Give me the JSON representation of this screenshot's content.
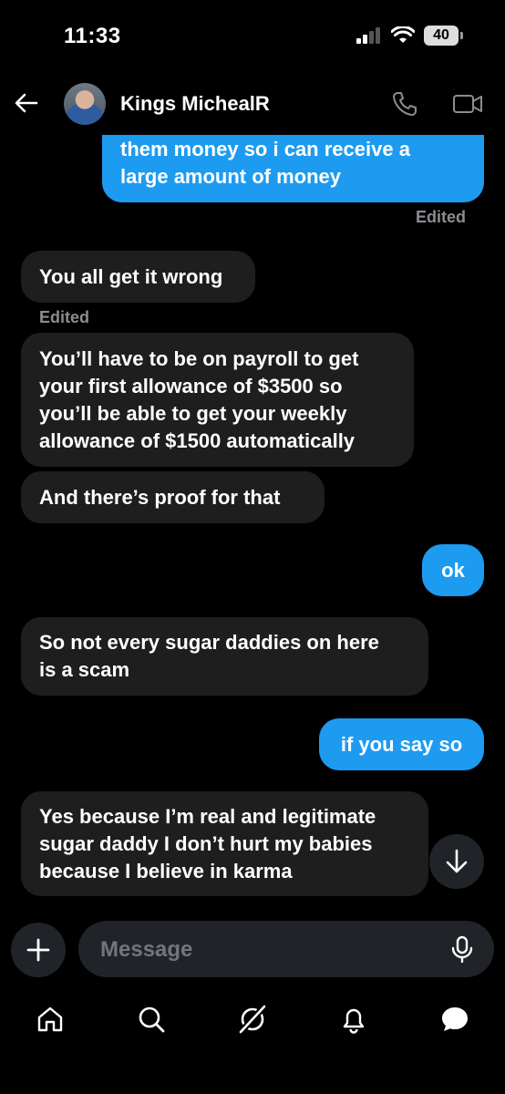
{
  "status": {
    "time": "11:33",
    "battery": "40"
  },
  "header": {
    "name": "Kings MichealR"
  },
  "messages": [
    {
      "dir": "out",
      "lines": [
        "them money so i can receive a",
        "large amount of money"
      ]
    },
    {
      "dir": "meta",
      "text": "Edited"
    },
    {
      "dir": "in",
      "lines": [
        "You all get it wrong"
      ]
    },
    {
      "dir": "meta",
      "text": "Edited"
    },
    {
      "dir": "in",
      "lines": [
        "You’ll have to be on payroll to get",
        "your first allowance of $3500 so",
        "you’ll be able to get your weekly",
        "allowance of $1500 automatically"
      ]
    },
    {
      "dir": "in",
      "lines": [
        "And there’s proof for that"
      ]
    },
    {
      "dir": "out",
      "lines": [
        "ok"
      ]
    },
    {
      "dir": "in",
      "lines": [
        "So not every sugar daddies on here",
        "is a scam"
      ]
    },
    {
      "dir": "out",
      "lines": [
        "if you say so"
      ]
    },
    {
      "dir": "in",
      "lines": [
        "Yes because I’m real and legitimate",
        "sugar daddy I don’t hurt my babies",
        "because I believe in karma"
      ]
    }
  ],
  "composer": {
    "placeholder": "Message"
  },
  "tabs": [
    "home-icon",
    "search-icon",
    "grok-icon",
    "notifications-icon",
    "messages-icon"
  ],
  "colors": {
    "accent": "#1d9bf0",
    "incoming": "#1e1e1e",
    "background": "#000000"
  }
}
